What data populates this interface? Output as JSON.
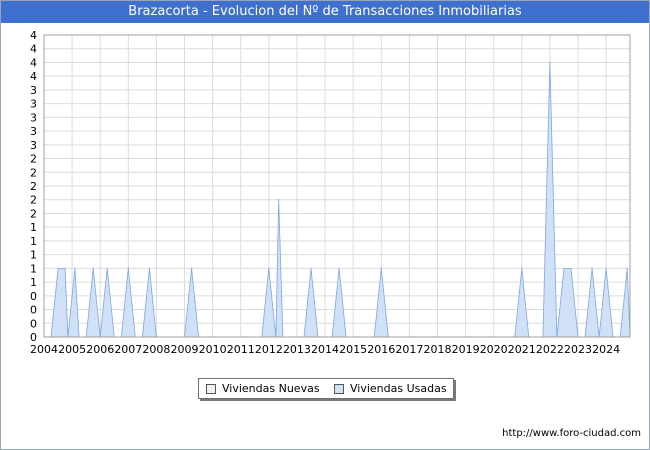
{
  "chart_data": {
    "type": "area",
    "title": "Brazacorta - Evolucion del Nº de Transacciones Inmobiliarias",
    "xlabel": "",
    "ylabel": "",
    "x_tick_labels": [
      "2004",
      "2005",
      "2006",
      "2007",
      "2008",
      "2009",
      "2010",
      "2011",
      "2012",
      "2013",
      "2014",
      "2015",
      "2016",
      "2017",
      "2018",
      "2019",
      "2020",
      "2021",
      "2022",
      "2023",
      "2024"
    ],
    "y_tick_labels": [
      "0",
      "0",
      "0",
      "0",
      "1",
      "1",
      "1",
      "1",
      "1",
      "2",
      "2",
      "2",
      "2",
      "2",
      "3",
      "3",
      "3",
      "3",
      "3",
      "4",
      "4",
      "4",
      "4"
    ],
    "ylim": [
      0,
      4.4
    ],
    "grid": true,
    "legend_position": "bottom",
    "series": [
      {
        "name": "Viviendas Nuevas",
        "color": "#f0f0f0",
        "x": [],
        "values": []
      },
      {
        "name": "Viviendas Usadas",
        "color": "#cfe0f7",
        "x": [
          2004.25,
          2004.5,
          2004.75,
          2004.85,
          2005.1,
          2005.25,
          2005.5,
          2005.75,
          2006.0,
          2006.25,
          2006.5,
          2006.75,
          2007.0,
          2007.25,
          2007.5,
          2007.75,
          2008.0,
          2009.0,
          2009.25,
          2009.5,
          2011.75,
          2012.0,
          2012.25,
          2012.35,
          2012.5,
          2012.75,
          2013.25,
          2013.5,
          2013.75,
          2014.25,
          2014.5,
          2014.75,
          2015.75,
          2016.0,
          2016.25,
          2020.75,
          2021.0,
          2021.25,
          2021.75,
          2022.0,
          2022.25,
          2022.5,
          2022.75,
          2023.0,
          2023.25,
          2023.5,
          2023.75,
          2024.0,
          2024.25,
          2024.5,
          2024.75,
          2024.85
        ],
        "values": [
          0,
          1,
          1,
          0,
          1,
          0,
          0,
          1,
          0,
          1,
          0,
          0,
          1,
          0,
          0,
          1,
          0,
          0,
          1,
          0,
          0,
          1,
          0,
          2,
          0,
          0,
          0,
          1,
          0,
          0,
          1,
          0,
          0,
          1,
          0,
          0,
          1,
          0,
          0,
          4,
          0,
          1,
          1,
          0,
          0,
          1,
          0,
          1,
          0,
          0,
          1,
          0
        ]
      }
    ]
  },
  "footer_text": "http://www.foro-ciudad.com"
}
